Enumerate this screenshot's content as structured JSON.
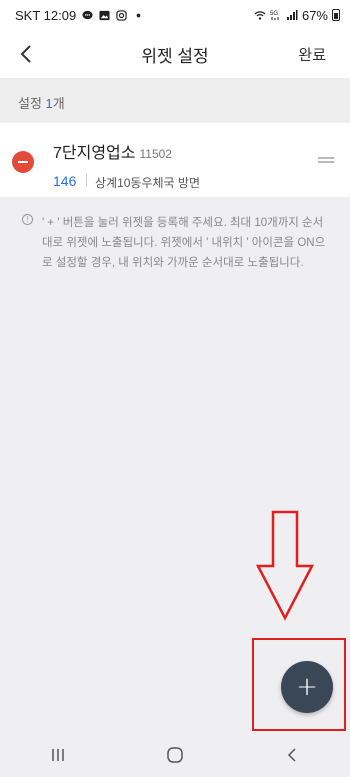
{
  "status_bar": {
    "carrier_time": "SKT 12:09",
    "battery": "67%",
    "icons": [
      "chat-icon",
      "image-icon",
      "instagram-icon",
      "dot-icon",
      "wifi-calling-icon",
      "5g-icon",
      "signal-icon",
      "battery-icon"
    ]
  },
  "app_bar": {
    "back_icon": "chevron-left-icon",
    "title": "위젯 설정",
    "done_label": "완료"
  },
  "count": {
    "label": "설정",
    "number": "1",
    "unit": "개"
  },
  "widget_item": {
    "stop_name": "7단지영업소",
    "stop_id": "11502",
    "route_number": "146",
    "direction": "상계10동우체국 방면"
  },
  "notice": {
    "text": "' + ' 버튼을 눌러 위젯을 등록해 주세요. 최대 10개까지 순서대로 위젯에 노출됩니다. 위젯에서 ' 내위치 ' 아이콘을 ON으로 설정할 경우, 내 위치와 가까운 순서대로 노출됩니다."
  },
  "fab": {
    "icon": "plus-icon",
    "label": "+"
  },
  "colors": {
    "accent_blue": "#2a6fd6",
    "remove_red": "#e24a3b",
    "fab_bg": "#3a4756",
    "annotation_red": "#e02020"
  },
  "nav_bar": {
    "icons": [
      "recent-apps-icon",
      "home-icon",
      "back-icon"
    ]
  }
}
